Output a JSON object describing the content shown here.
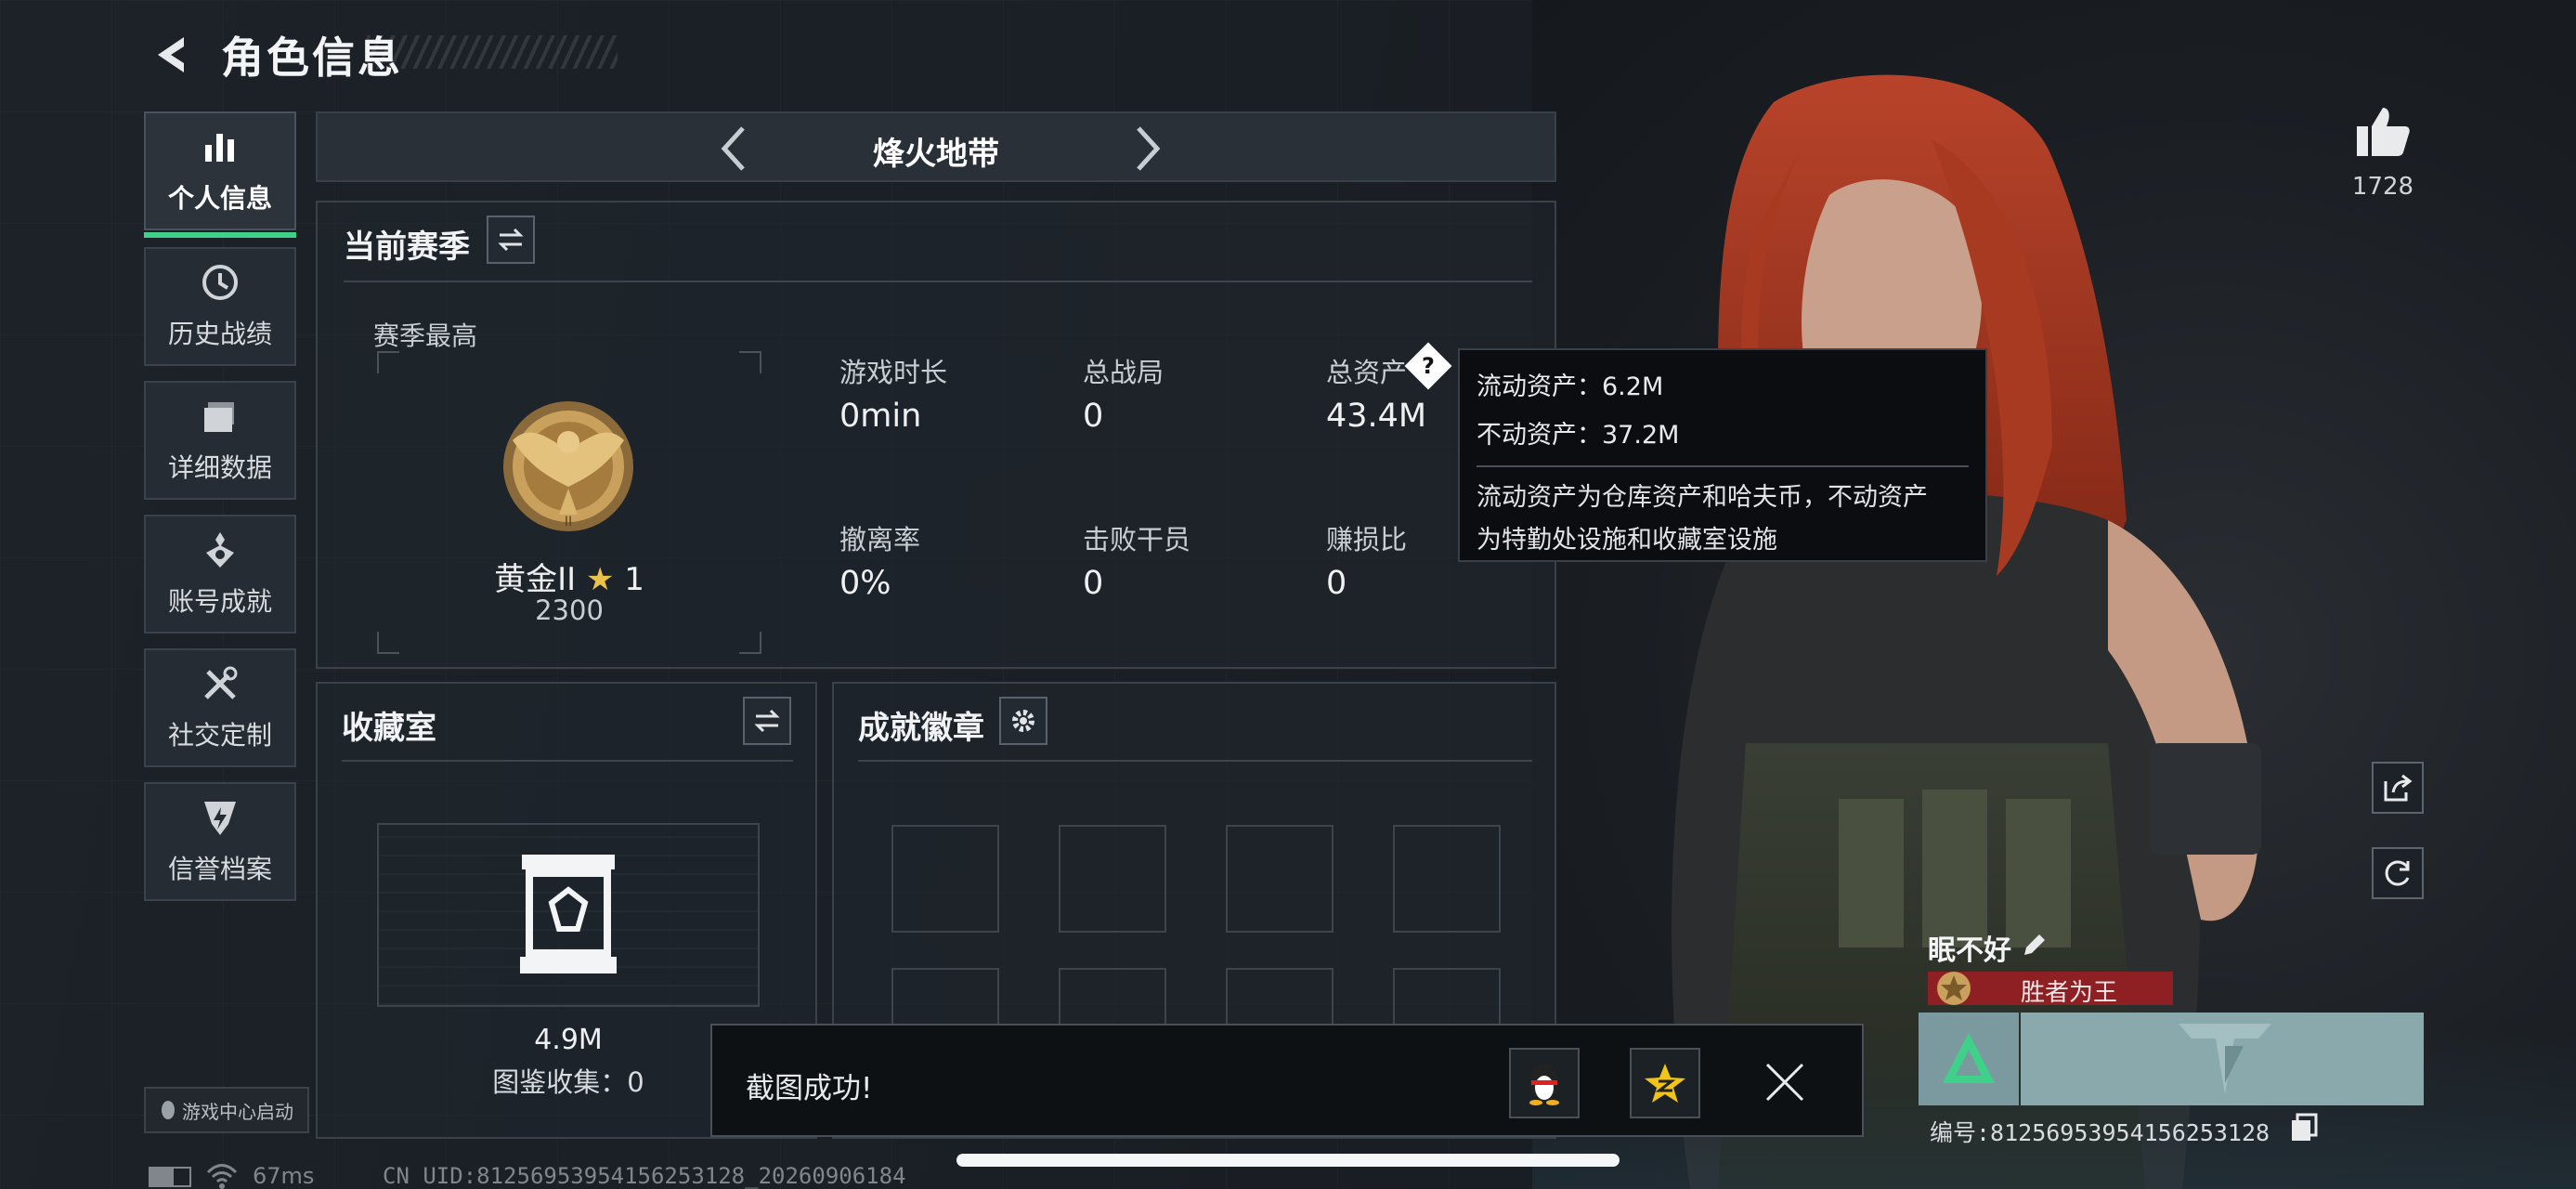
{
  "header": {
    "title": "角色信息"
  },
  "nav": {
    "items": [
      {
        "label": "个人信息",
        "icon": "bar-chart-icon",
        "active": true
      },
      {
        "label": "历史战绩",
        "icon": "clock-icon"
      },
      {
        "label": "详细数据",
        "icon": "folder-icon"
      },
      {
        "label": "账号成就",
        "icon": "medal-icon"
      },
      {
        "label": "社交定制",
        "icon": "tools-icon"
      },
      {
        "label": "信誉档案",
        "icon": "shield-icon"
      }
    ],
    "game_center": "游戏中心启动"
  },
  "mode": {
    "name": "烽火地带"
  },
  "season": {
    "title": "当前赛季",
    "best_label": "赛季最高",
    "rank_name": "黄金II",
    "rank_stars": "1",
    "rank_points": "2300",
    "stats": [
      {
        "label": "游戏时长",
        "value": "0min"
      },
      {
        "label": "总战局",
        "value": "0"
      },
      {
        "label": "总资产",
        "value": "43.4M"
      },
      {
        "label": "撤离率",
        "value": "0%"
      },
      {
        "label": "击败干员",
        "value": "0"
      },
      {
        "label": "赚损比",
        "value": "0"
      }
    ]
  },
  "tooltip": {
    "liquid": "流动资产：6.2M",
    "fixed": "不动资产：37.2M",
    "desc_1": "流动资产为仓库资产和哈夫币，不动资产",
    "desc_2": "为特勤处设施和收藏室设施"
  },
  "collection": {
    "title": "收藏室",
    "value": "4.9M",
    "catalog": "图鉴收集：0"
  },
  "badges": {
    "title": "成就徽章"
  },
  "toast": {
    "text": "截图成功!"
  },
  "profile": {
    "likes": "1728",
    "name": "眠不好",
    "title_badge": "胜者为王",
    "id_line": "编号:81256953954156253128"
  },
  "status": {
    "ping": "67ms",
    "uid": "CN UID:81256953954156253128_20260906184"
  },
  "colors": {
    "accent": "#3fd18a",
    "title_red": "#8e1f22"
  }
}
